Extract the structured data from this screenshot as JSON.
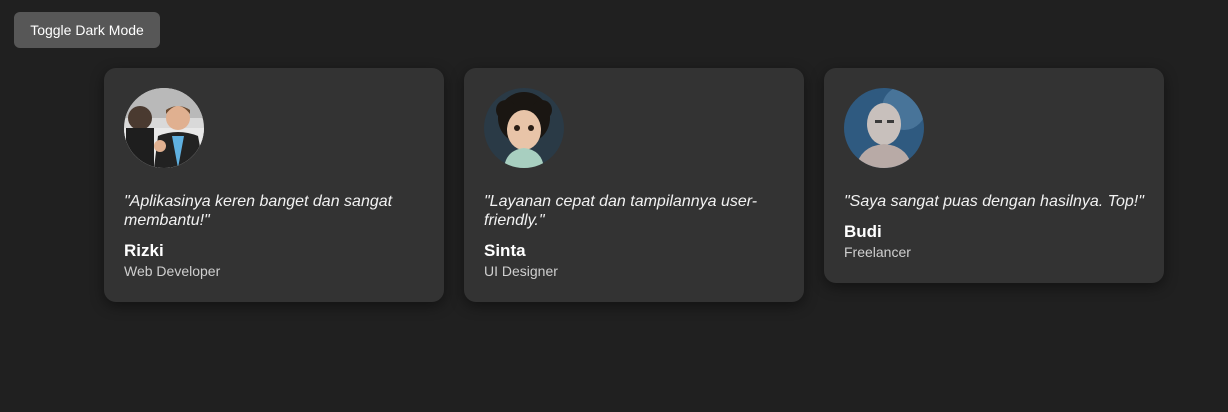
{
  "toolbar": {
    "toggle_label": "Toggle Dark Mode"
  },
  "testimonials": [
    {
      "quote": "\"Aplikasinya keren banget dan sangat membantu!\"",
      "name": "Rizki",
      "role": "Web Developer",
      "avatar_icon": "person-photo-icon"
    },
    {
      "quote": "\"Layanan cepat dan tampilannya user-friendly.\"",
      "name": "Sinta",
      "role": "UI Designer",
      "avatar_icon": "person-photo-icon"
    },
    {
      "quote": "\"Saya sangat puas dengan hasilnya. Top!\"",
      "name": "Budi",
      "role": "Freelancer",
      "avatar_icon": "person-photo-icon"
    }
  ],
  "colors": {
    "background": "#202020",
    "card": "#333333",
    "button": "#575757",
    "text": "#ffffff",
    "muted_text": "#cfcfcf"
  }
}
